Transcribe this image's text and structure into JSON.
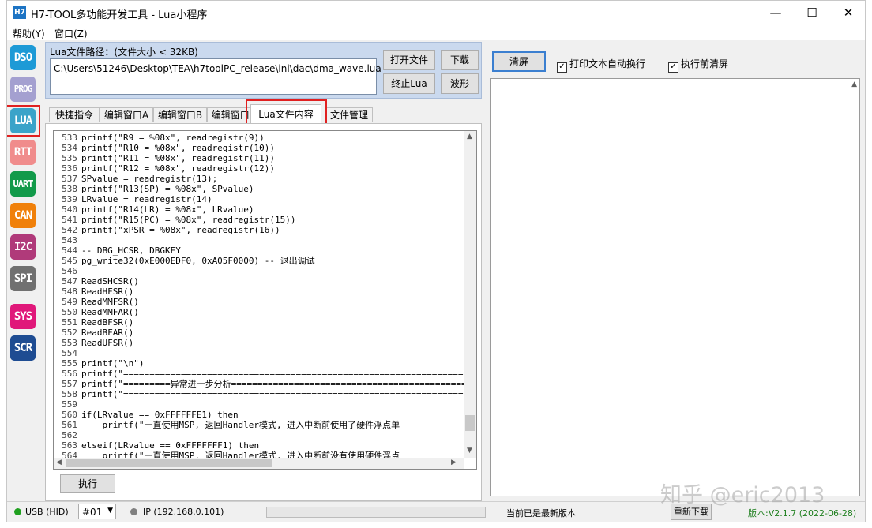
{
  "window": {
    "app_icon_text": "H7",
    "title": "H7-TOOL多功能开发工具 - Lua小程序",
    "minimize": "—",
    "maximize": "☐",
    "close": "✕"
  },
  "menu": [
    {
      "label": "帮助(Y)"
    },
    {
      "label": "窗口(Z)"
    }
  ],
  "toolbar": [
    {
      "label": "DSO",
      "color": "#1e9ad6"
    },
    {
      "label": "PROG",
      "color": "#a4a0d0"
    },
    {
      "label": "LUA",
      "color": "#3aa3c9",
      "selected": true
    },
    {
      "label": "RTT",
      "color": "#f08c8c"
    },
    {
      "label": "UART",
      "color": "#129a4a"
    },
    {
      "label": "CAN",
      "color": "#f0800a"
    },
    {
      "label": "I2C",
      "color": "#b03a7a"
    },
    {
      "label": "SPI",
      "color": "#707070"
    },
    {
      "label": "SYS",
      "color": "#e0187a"
    },
    {
      "label": "SCR",
      "color": "#1e4c92"
    }
  ],
  "lua_file": {
    "path_label": "Lua文件路径：(文件大小 < 32KB)",
    "path_value": "C:\\Users\\51246\\Desktop\\TEA\\h7toolPC_release\\ini\\dac\\dma_wave.lua",
    "buttons": {
      "open": "打开文件",
      "download": "下载",
      "stop": "终止Lua",
      "wave": "波形"
    }
  },
  "tabs": [
    {
      "label": "快捷指令"
    },
    {
      "label": "编辑窗口A"
    },
    {
      "label": "编辑窗口B"
    },
    {
      "label": "编辑窗口C"
    },
    {
      "label": "Lua文件内容",
      "active": true
    },
    {
      "label": "文件管理"
    }
  ],
  "code_lines": [
    {
      "n": "533",
      "t": "printf(\"R9 = %08x\", readregistr(9))"
    },
    {
      "n": "534",
      "t": "printf(\"R10 = %08x\", readregistr(10))"
    },
    {
      "n": "535",
      "t": "printf(\"R11 = %08x\", readregistr(11))"
    },
    {
      "n": "536",
      "t": "printf(\"R12 = %08x\", readregistr(12))"
    },
    {
      "n": "537",
      "t": "SPvalue = readregistr(13);"
    },
    {
      "n": "538",
      "t": "printf(\"R13(SP) = %08x\", SPvalue)"
    },
    {
      "n": "539",
      "t": "LRvalue = readregistr(14)"
    },
    {
      "n": "540",
      "t": "printf(\"R14(LR) = %08x\", LRvalue)"
    },
    {
      "n": "541",
      "t": "printf(\"R15(PC) = %08x\", readregistr(15))"
    },
    {
      "n": "542",
      "t": "printf(\"xPSR = %08x\", readregistr(16))"
    },
    {
      "n": "543",
      "t": ""
    },
    {
      "n": "544",
      "t": "-- DBG_HCSR, DBGKEY"
    },
    {
      "n": "545",
      "t": "pg_write32(0xE000EDF0, 0xA05F0000) -- 退出调试"
    },
    {
      "n": "546",
      "t": ""
    },
    {
      "n": "547",
      "t": "ReadSHCSR()"
    },
    {
      "n": "548",
      "t": "ReadHFSR()"
    },
    {
      "n": "549",
      "t": "ReadMMFSR()"
    },
    {
      "n": "550",
      "t": "ReadMMFAR()"
    },
    {
      "n": "551",
      "t": "ReadBFSR()"
    },
    {
      "n": "552",
      "t": "ReadBFAR()"
    },
    {
      "n": "553",
      "t": "ReadUFSR()"
    },
    {
      "n": "554",
      "t": ""
    },
    {
      "n": "555",
      "t": "printf(\"\\n\")"
    },
    {
      "n": "556",
      "t": "printf(\"===================================================================="
    },
    {
      "n": "557",
      "t": "printf(\"=========异常进一步分析======================================================"
    },
    {
      "n": "558",
      "t": "printf(\"===================================================================="
    },
    {
      "n": "559",
      "t": ""
    },
    {
      "n": "560",
      "t": "if(LRvalue == 0xFFFFFFE1) then"
    },
    {
      "n": "561",
      "t": "    printf(\"一直使用MSP, 返回Handler模式, 进入中断前使用了硬件浮点单"
    },
    {
      "n": "562",
      "t": ""
    },
    {
      "n": "563",
      "t": "elseif(LRvalue == 0xFFFFFFF1) then"
    },
    {
      "n": "564",
      "t": "    printf(\"一直使用MSP, 返回Handler模式, 进入中断前没有使用硬件浮点"
    },
    {
      "n": "565",
      "t": ""
    }
  ],
  "execute_button": "执行",
  "right": {
    "clear_button": "清屏",
    "auto_wrap": "打印文本自动换行",
    "clear_before_exec": "执行前清屏"
  },
  "status": {
    "usb": "USB (HID)",
    "usb_color": "#20a020",
    "device": "#01",
    "ip": "IP (192.168.0.101)",
    "ip_color": "#808080",
    "latest": "当前已是最新版本",
    "redownload": "重新下载",
    "version": "版本:V2.1.7 (2022-06-28)",
    "version_color": "#208020"
  },
  "watermark": "知乎 @eric2013"
}
